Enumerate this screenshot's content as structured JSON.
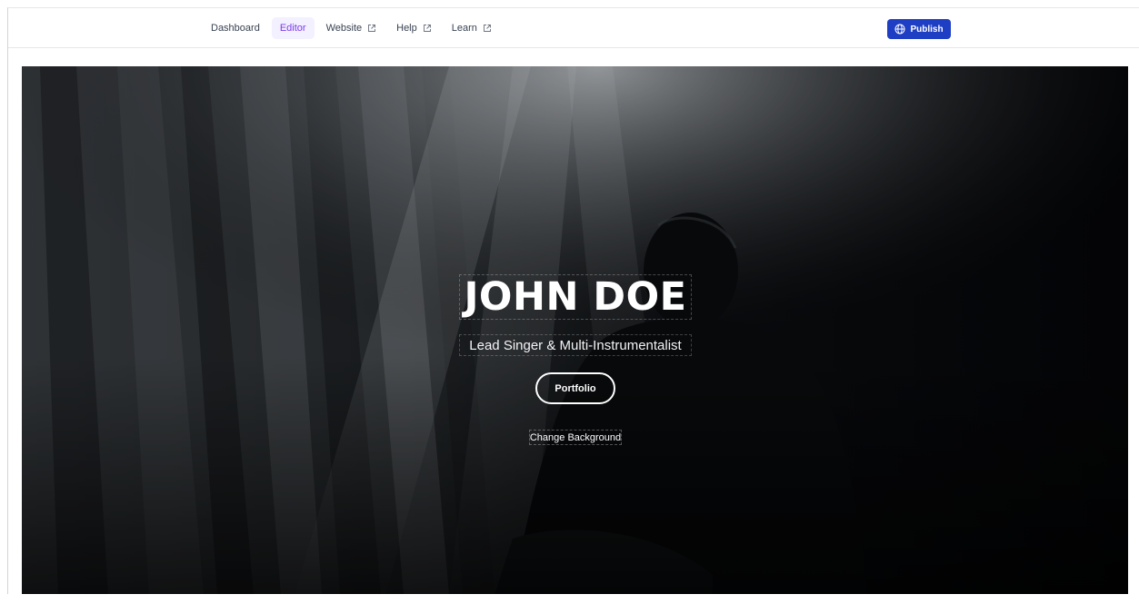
{
  "nav": {
    "items": [
      {
        "label": "Dashboard",
        "external": false,
        "active": false
      },
      {
        "label": "Editor",
        "external": false,
        "active": true
      },
      {
        "label": "Website",
        "external": true,
        "active": false
      },
      {
        "label": "Help",
        "external": true,
        "active": false
      },
      {
        "label": "Learn",
        "external": true,
        "active": false
      }
    ],
    "external_icon": "external-link-icon",
    "active_color": "#7c3aed"
  },
  "publish": {
    "label": "Publish",
    "icon": "globe-icon",
    "color": "#1e3fc4"
  },
  "hero": {
    "title": "JOHN DOE",
    "subtitle": "Lead Singer & Multi-Instrumentalist",
    "cta_label": "Portfolio",
    "change_background_label": "Change Background",
    "background": "dark concert photo of a musician in stage light rays"
  }
}
